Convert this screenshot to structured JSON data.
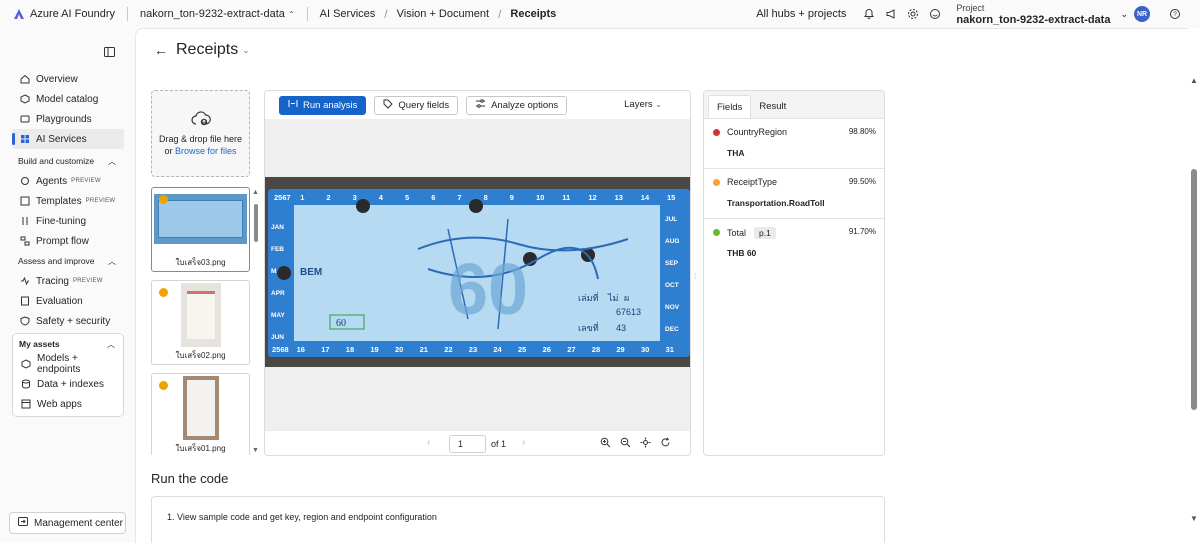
{
  "topbar": {
    "brand": "Azure AI Foundry",
    "project_crumb": "nakorn_ton-9232-extract-data",
    "breadcrumbs": [
      "AI Services",
      "Vision + Document",
      "Receipts"
    ],
    "all_hubs": "All hubs + projects",
    "project_label": "Project",
    "project_name": "nakorn_ton-9232-extract-data",
    "avatar": "NR"
  },
  "sidebar": {
    "items": [
      {
        "label": "Overview",
        "icon": "home-icon"
      },
      {
        "label": "Model catalog",
        "icon": "cube-icon"
      },
      {
        "label": "Playgrounds",
        "icon": "playground-icon"
      },
      {
        "label": "AI Services",
        "icon": "ai-services-icon"
      }
    ],
    "build_section": "Build and customize",
    "build_items": [
      {
        "label": "Agents",
        "badge": "PREVIEW"
      },
      {
        "label": "Templates",
        "badge": "PREVIEW"
      },
      {
        "label": "Fine-tuning",
        "badge": ""
      },
      {
        "label": "Prompt flow",
        "badge": ""
      }
    ],
    "assess_section": "Assess and improve",
    "assess_items": [
      {
        "label": "Tracing",
        "badge": "PREVIEW"
      },
      {
        "label": "Evaluation",
        "badge": ""
      },
      {
        "label": "Safety + security",
        "badge": ""
      }
    ],
    "assets_section": "My assets",
    "assets_items": [
      {
        "label": "Models + endpoints"
      },
      {
        "label": "Data + indexes"
      },
      {
        "label": "Web apps"
      }
    ],
    "management": "Management center"
  },
  "main": {
    "title": "Receipts",
    "dropzone": {
      "line1": "Drag & drop file here",
      "line2_prefix": "or ",
      "line2_link": "Browse for files"
    },
    "files": [
      "ใบเสร็จ03.png",
      "ใบเสร็จ02.png",
      "ใบเสร็จ01.png"
    ],
    "toolbar": {
      "run": "Run analysis",
      "query": "Query fields",
      "analyze": "Analyze options",
      "layers": "Layers"
    },
    "pager": {
      "page": "1",
      "of": "of 1"
    },
    "tabs": [
      "Fields",
      "Result"
    ],
    "fields": [
      {
        "name": "CountryRegion",
        "confidence": "98.80%",
        "value": "THA",
        "color": "#d13438",
        "page": ""
      },
      {
        "name": "ReceiptType",
        "confidence": "99.50%",
        "value": "Transportation.RoadToll",
        "color": "#f7a33a",
        "page": ""
      },
      {
        "name": "Total",
        "confidence": "91.70%",
        "value": "THB 60",
        "color": "#6bb72d",
        "page": "p.1"
      }
    ],
    "run_title": "Run the code",
    "code_step": "1. View sample code and get key, region and endpoint configuration"
  },
  "ticket": {
    "top_numbers": [
      "2567",
      "1",
      "2",
      "3",
      "4",
      "5",
      "6",
      "7",
      "8",
      "9",
      "10",
      "11",
      "12",
      "13",
      "14",
      "15"
    ],
    "bottom_numbers": [
      "2568",
      "16",
      "17",
      "18",
      "19",
      "20",
      "21",
      "22",
      "23",
      "24",
      "25",
      "26",
      "27",
      "28",
      "29",
      "30",
      "31"
    ],
    "months_left": [
      "JAN",
      "FEB",
      "MAR",
      "APR",
      "MAY",
      "JUN"
    ],
    "months_right": [
      "JUL",
      "AUG",
      "SEP",
      "OCT",
      "NOV",
      "DEC"
    ],
    "logo": "BEM",
    "amount": "60",
    "big_number": "60",
    "receipt_no_label": "เล่มที่",
    "receipt_no": "67613",
    "seq_label": "เลขที่",
    "seq": "43",
    "side_a": "ไม่",
    "side_b": "ผ"
  }
}
